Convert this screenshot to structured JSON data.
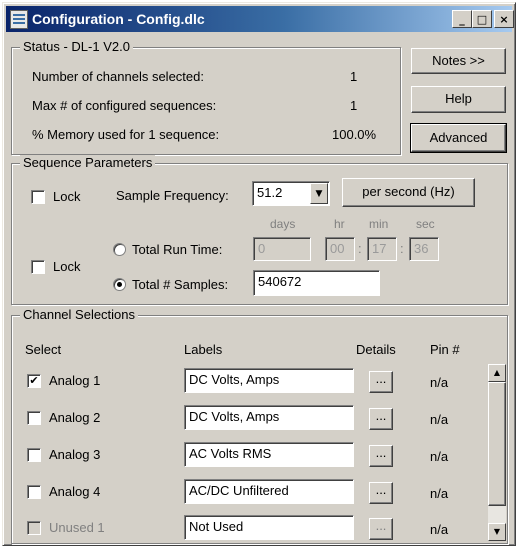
{
  "window": {
    "title": "Configuration - Config.dlc",
    "controls": {
      "minimize": "_",
      "maximize": "□",
      "close": "×"
    }
  },
  "status": {
    "legend": "Status - DL-1 V2.0",
    "rows": [
      {
        "label": "Number of channels selected:",
        "value": "1"
      },
      {
        "label": "Max # of configured sequences:",
        "value": "1"
      },
      {
        "label": "% Memory used for 1 sequence:",
        "value": "100.0%"
      }
    ]
  },
  "buttons": {
    "notes": "Notes >>",
    "help": "Help",
    "advanced": "Advanced"
  },
  "sequence": {
    "legend": "Sequence Parameters",
    "lock_label": "Lock",
    "sample_frequency_label": "Sample Frequency:",
    "sample_frequency_value": "51.2",
    "per_second_button": "per second (Hz)",
    "time_headers": {
      "days": "days",
      "hr": "hr",
      "min": "min",
      "sec": "sec"
    },
    "total_run_time_label": "Total Run Time:",
    "run_time": {
      "days": "0",
      "hr": "00",
      "min": "17",
      "sec": "36",
      "sep": ":"
    },
    "total_samples_label": "Total # Samples:",
    "total_samples_value": "540672",
    "lock1_checked": false,
    "lock2_checked": false,
    "run_time_selected": false,
    "total_samples_selected": true
  },
  "channels": {
    "legend": "Channel Selections",
    "headers": {
      "select": "Select",
      "labels": "Labels",
      "details": "Details",
      "pin": "Pin #"
    },
    "details_button": "...",
    "rows": [
      {
        "name": "Analog 1",
        "label": "DC Volts, Amps",
        "pin": "n/a",
        "checked": true,
        "enabled": true
      },
      {
        "name": "Analog 2",
        "label": "DC Volts, Amps",
        "pin": "n/a",
        "checked": false,
        "enabled": true
      },
      {
        "name": "Analog 3",
        "label": "AC Volts RMS",
        "pin": "n/a",
        "checked": false,
        "enabled": true
      },
      {
        "name": "Analog 4",
        "label": "AC/DC Unfiltered",
        "pin": "n/a",
        "checked": false,
        "enabled": true
      },
      {
        "name": "Unused 1",
        "label": "Not Used",
        "pin": "n/a",
        "checked": false,
        "enabled": false
      }
    ],
    "scroll_up": "▲",
    "scroll_down": "▼"
  }
}
